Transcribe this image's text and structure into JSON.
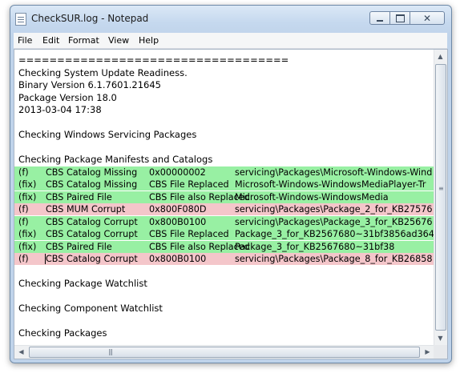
{
  "window": {
    "title": "CheckSUR.log - Notepad"
  },
  "menu": [
    "File",
    "Edit",
    "Format",
    "View",
    "Help"
  ],
  "lines_top": [
    "===================================",
    "Checking System Update Readiness.",
    "Binary Version 6.1.7601.21645",
    "Package Version 18.0",
    "2013-03-04 17:38",
    "",
    "Checking Windows Servicing Packages",
    "",
    "Checking Package Manifests and Catalogs"
  ],
  "rows": [
    {
      "status": "fix",
      "tag": "(f)",
      "issue": "CBS Catalog Missing",
      "code": "0x00000002",
      "path": "servicing\\Packages\\Microsoft-Windows-Wind"
    },
    {
      "status": "fix",
      "tag": "(fix)",
      "issue": "CBS Catalog Missing",
      "code": "CBS File Replaced",
      "path": "Microsoft-Windows-WindowsMediaPlayer-Tr"
    },
    {
      "status": "fix",
      "tag": "(fix)",
      "issue": "CBS Paired File",
      "code": "CBS File also Replaced",
      "path": "Microsoft-Windows-WindowsMedia"
    },
    {
      "status": "fail",
      "tag": "(f)",
      "issue": "CBS MUM Corrupt",
      "code": "0x800F080D",
      "path": "servicing\\Packages\\Package_2_for_KB27576"
    },
    {
      "status": "fix",
      "tag": "(f)",
      "issue": "CBS Catalog Corrupt",
      "code": "0x800B0100",
      "path": "servicing\\Packages\\Package_3_for_KB25676"
    },
    {
      "status": "fix",
      "tag": "(fix)",
      "issue": "CBS Catalog Corrupt",
      "code": "CBS File Replaced",
      "path": "Package_3_for_KB2567680~31bf3856ad364e"
    },
    {
      "status": "fix",
      "tag": "(fix)",
      "issue": "CBS Paired File",
      "code": "CBS File also Replaced",
      "path": "Package_3_for_KB2567680~31bf38"
    },
    {
      "status": "fail",
      "tag": "(f)",
      "issue": "CBS Catalog Corrupt",
      "code": "0x800B0100",
      "path": "servicing\\Packages\\Package_8_for_KB26858"
    }
  ],
  "lines_bottom": [
    "",
    "Checking Package Watchlist",
    "",
    "Checking Component Watchlist",
    "",
    "Checking Packages"
  ],
  "colors": {
    "fix_row": "#98f0a3",
    "fail_row": "#f4c6ca"
  },
  "icons": {
    "app": "notepad-icon",
    "minimize": "minimize-icon",
    "maximize": "maximize-icon",
    "close": "close-icon"
  }
}
